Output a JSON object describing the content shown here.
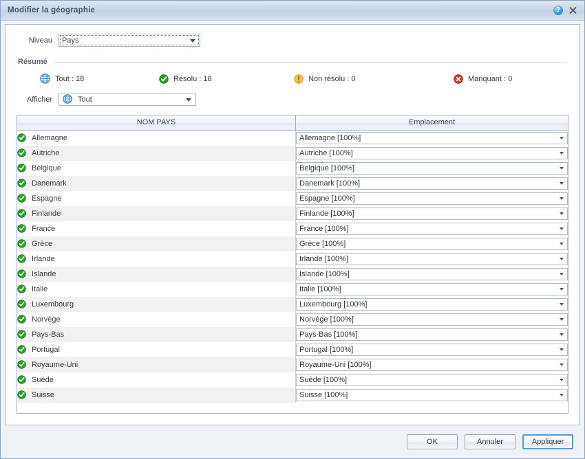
{
  "window": {
    "title": "Modifier la géographie",
    "help_icon": "help-icon",
    "close_icon": "close-icon"
  },
  "form": {
    "niveau_label": "Niveau",
    "niveau_value": "Pays",
    "afficher_label": "Afficher",
    "afficher_value": "Tout",
    "afficher_icon": "globe-icon"
  },
  "summary": {
    "title": "Résumé",
    "items": [
      {
        "icon": "globe-icon",
        "label": "Tout : 18",
        "color": "#3f8fd0"
      },
      {
        "icon": "check-icon",
        "label": "Résolu : 18",
        "color": "#33a532"
      },
      {
        "icon": "warning-icon",
        "label": "Non résolu : 0",
        "color": "#e8b029"
      },
      {
        "icon": "error-icon",
        "label": "Manquant : 0",
        "color": "#d93025"
      }
    ]
  },
  "table": {
    "columns": [
      "NOM PAYS",
      "Emplacement"
    ],
    "rows": [
      {
        "status": "check-icon",
        "name": "Allemagne",
        "location": "Allemagne [100%]"
      },
      {
        "status": "check-icon",
        "name": "Autriche",
        "location": "Autriche [100%]"
      },
      {
        "status": "check-icon",
        "name": "Belgique",
        "location": "Belgique [100%]"
      },
      {
        "status": "check-icon",
        "name": "Danemark",
        "location": "Danemark [100%]"
      },
      {
        "status": "check-icon",
        "name": "Espagne",
        "location": "Espagne [100%]"
      },
      {
        "status": "check-icon",
        "name": "Finlande",
        "location": "Finlande [100%]"
      },
      {
        "status": "check-icon",
        "name": "France",
        "location": "France [100%]"
      },
      {
        "status": "check-icon",
        "name": "Grèce",
        "location": "Grèce [100%]"
      },
      {
        "status": "check-icon",
        "name": "Irlande",
        "location": "Irlande [100%]"
      },
      {
        "status": "check-icon",
        "name": "Islande",
        "location": "Islande [100%]"
      },
      {
        "status": "check-icon",
        "name": "Italie",
        "location": "Italie [100%]"
      },
      {
        "status": "check-icon",
        "name": "Luxembourg",
        "location": "Luxembourg [100%]"
      },
      {
        "status": "check-icon",
        "name": "Norvège",
        "location": "Norvège [100%]"
      },
      {
        "status": "check-icon",
        "name": "Pays-Bas",
        "location": "Pays-Bas [100%]"
      },
      {
        "status": "check-icon",
        "name": "Portugal",
        "location": "Portugal [100%]"
      },
      {
        "status": "check-icon",
        "name": "Royaume-Uni",
        "location": "Royaume-Uni [100%]"
      },
      {
        "status": "check-icon",
        "name": "Suède",
        "location": "Suède [100%]"
      },
      {
        "status": "check-icon",
        "name": "Suisse",
        "location": "Suisse [100%]"
      }
    ]
  },
  "footer": {
    "ok_label": "OK",
    "cancel_label": "Annuler",
    "apply_label": "Appliquer"
  },
  "colors": {
    "accent": "#4f9fd4",
    "titlebar": "#ccd8e8",
    "green": "#33a532",
    "orange": "#e8b029",
    "red": "#d93025",
    "blue": "#3f8fd0"
  }
}
